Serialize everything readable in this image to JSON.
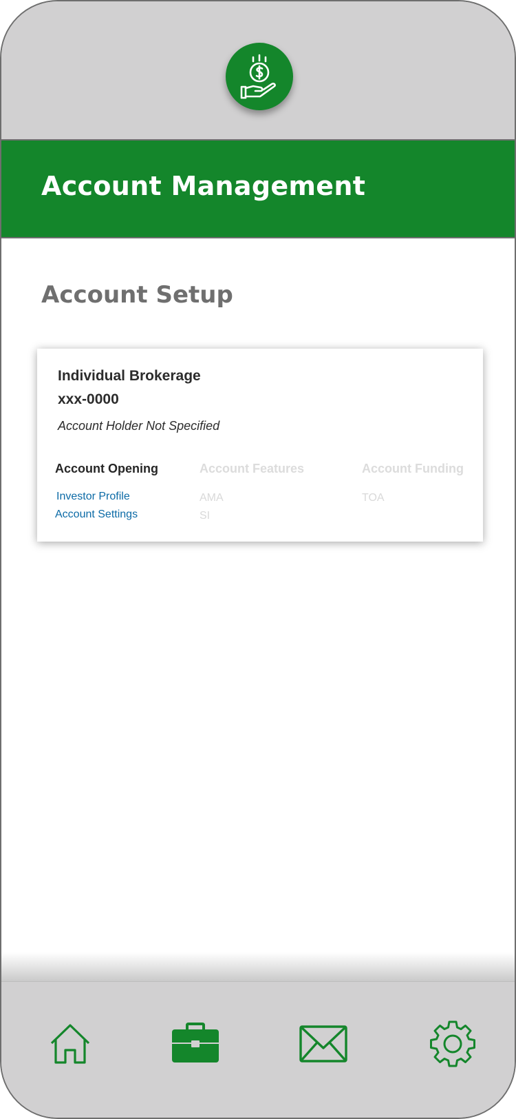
{
  "header": {
    "title": "Account Management"
  },
  "section": {
    "title": "Account Setup"
  },
  "account": {
    "name": "Individual Brokerage",
    "number": "xxx-0000",
    "holder": "Account Holder Not Specified"
  },
  "columns": [
    {
      "heading": "Account Opening",
      "items": [
        "Investor Profile",
        "Account Settings"
      ]
    },
    {
      "heading": "Account Features",
      "items": [
        "AMA",
        "SI"
      ]
    },
    {
      "heading": "Account Funding",
      "items": [
        "TOA"
      ]
    }
  ],
  "nav": [
    {
      "icon": "home-icon"
    },
    {
      "icon": "briefcase-icon",
      "active": true
    },
    {
      "icon": "mail-icon"
    },
    {
      "icon": "gear-icon"
    }
  ],
  "colors": {
    "brand_green": "#14862b",
    "chrome_gray": "#d1d0d1",
    "link_blue": "#0b6aa6",
    "disabled_text": "#dcdcdc"
  }
}
